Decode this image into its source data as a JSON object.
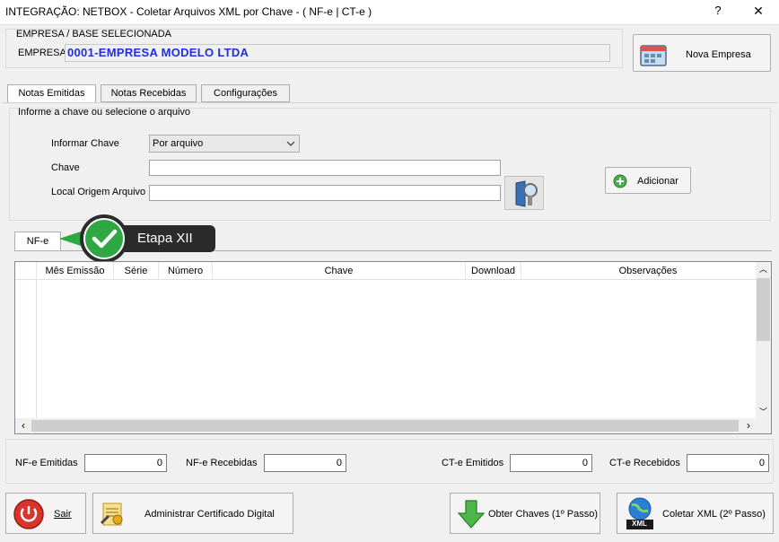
{
  "window": {
    "title": "INTEGRAÇÃO: NETBOX - Coletar Arquivos XML por Chave - ( NF-e | CT-e )",
    "help_label": "?",
    "close_label": "✕"
  },
  "empresa": {
    "section_label": "EMPRESA  /  BASE  SELECIONADA",
    "field_label": "EMPRESA",
    "value": "0001-EMPRESA MODELO LTDA",
    "nova_button": "Nova Empresa"
  },
  "tabs": [
    {
      "label": "Notas Emitidas",
      "active": true
    },
    {
      "label": "Notas Recebidas",
      "active": false
    },
    {
      "label": "Configurações",
      "active": false
    }
  ],
  "form": {
    "group_label": "Informe a chave ou selecione o arquivo",
    "informar_label": "Informar Chave",
    "informar_value": "Por arquivo",
    "chave_label": "Chave",
    "chave_value": "",
    "local_label": "Local Origem Arquivo",
    "local_value": "",
    "adicionar_button": "Adicionar"
  },
  "subtab": {
    "label": "NF-e"
  },
  "callout": {
    "label": "Etapa XII"
  },
  "grid": {
    "columns": [
      "Mês Emissão",
      "Série",
      "Número",
      "Chave",
      "Download",
      "Observações"
    ],
    "rows": []
  },
  "counts": {
    "nfe_emitidas_label": "NF-e Emitidas",
    "nfe_emitidas_value": "0",
    "nfe_recebidas_label": "NF-e Recebidas",
    "nfe_recebidas_value": "0",
    "cte_emitidos_label": "CT-e Emitidos",
    "cte_emitidos_value": "0",
    "cte_recebidos_label": "CT-e Recebidos",
    "cte_recebidos_value": "0"
  },
  "actions": {
    "sair": "Sair",
    "certificado": "Administrar Certificado Digital",
    "obter": "Obter Chaves (1º Passo)",
    "coletar": "Coletar XML (2º Passo)",
    "xml_badge": "XML"
  },
  "colors": {
    "empresa_text": "#1d2fe0",
    "callout_bg": "#2b2b2b",
    "callout_green": "#2fa844"
  }
}
